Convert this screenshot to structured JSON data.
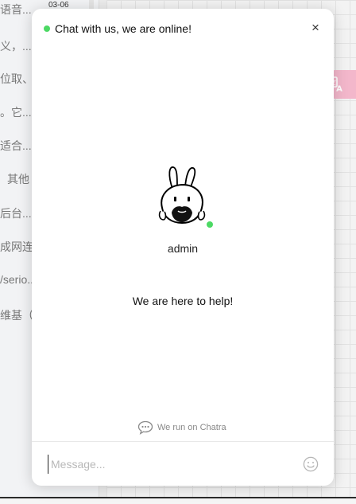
{
  "background": {
    "date": "03-06",
    "rows": [
      "语音...",
      "义，...",
      "位取、...",
      "。它...",
      "适合...",
      "其他",
      "后台...",
      "成网连...",
      "/serio...",
      "维基（..."
    ]
  },
  "translate_button": {
    "icon": "translate-icon"
  },
  "chat": {
    "header": {
      "title": "Chat with us, we are online!",
      "close_label": "×",
      "status_color": "#4cd964"
    },
    "agent": {
      "name": "admin",
      "status_color": "#4cd964"
    },
    "help_text": "We are here to help!",
    "powered_by": "We run on Chatra",
    "message": {
      "placeholder": "Message...",
      "value": ""
    },
    "emoji_icon": "smiley-icon"
  }
}
